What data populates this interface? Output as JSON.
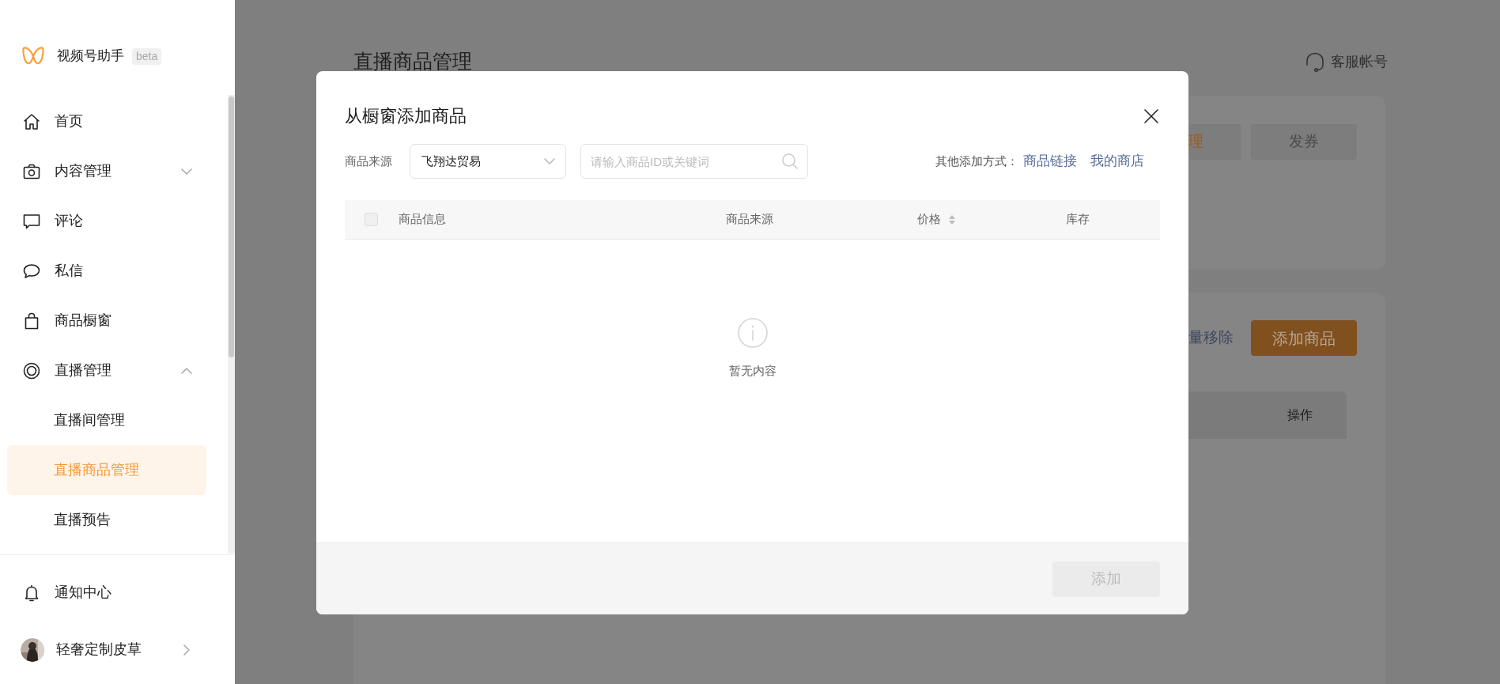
{
  "sidebar": {
    "logo": {
      "name": "视频号助手",
      "badge": "beta"
    },
    "items": [
      {
        "label": "首页",
        "selected": false
      },
      {
        "label": "内容管理",
        "selected": false,
        "expanded": false
      },
      {
        "label": "评论",
        "selected": false
      },
      {
        "label": "私信",
        "selected": false
      },
      {
        "label": "商品橱窗",
        "selected": false
      },
      {
        "label": "直播管理",
        "selected": false,
        "expanded": true,
        "children": [
          {
            "label": "直播间管理",
            "selected": false
          },
          {
            "label": "直播商品管理",
            "selected": true
          },
          {
            "label": "直播预告",
            "selected": false
          }
        ]
      }
    ],
    "notifications": {
      "label": "通知中心"
    },
    "user": {
      "name": "轻奢定制皮草"
    }
  },
  "main": {
    "title": "直播商品管理",
    "service_account": "客服帐号",
    "card_buttons": [
      {
        "label": "理",
        "kind": "accent"
      },
      {
        "label": "发券",
        "kind": "plain"
      }
    ],
    "remove_link": "量移除",
    "add_button": "添加商品",
    "table_columns": [
      "操作"
    ]
  },
  "modal": {
    "title": "从橱窗添加商品",
    "source_label": "商品来源",
    "source_select": {
      "value": "飞翔达贸易"
    },
    "search": {
      "placeholder": "请输入商品ID或关键词"
    },
    "other_methods": {
      "label": "其他添加方式：",
      "links": [
        "商品链接",
        "我的商店"
      ]
    },
    "table": {
      "select_all": {
        "checked": false
      },
      "columns": [
        {
          "label": "商品信息",
          "sortable": false
        },
        {
          "label": "商品来源",
          "sortable": false
        },
        {
          "label": "价格",
          "sortable": true
        },
        {
          "label": "库存",
          "sortable": false
        }
      ]
    },
    "empty_text": "暂无内容",
    "footer_button": {
      "label": "添加",
      "disabled": true
    }
  }
}
